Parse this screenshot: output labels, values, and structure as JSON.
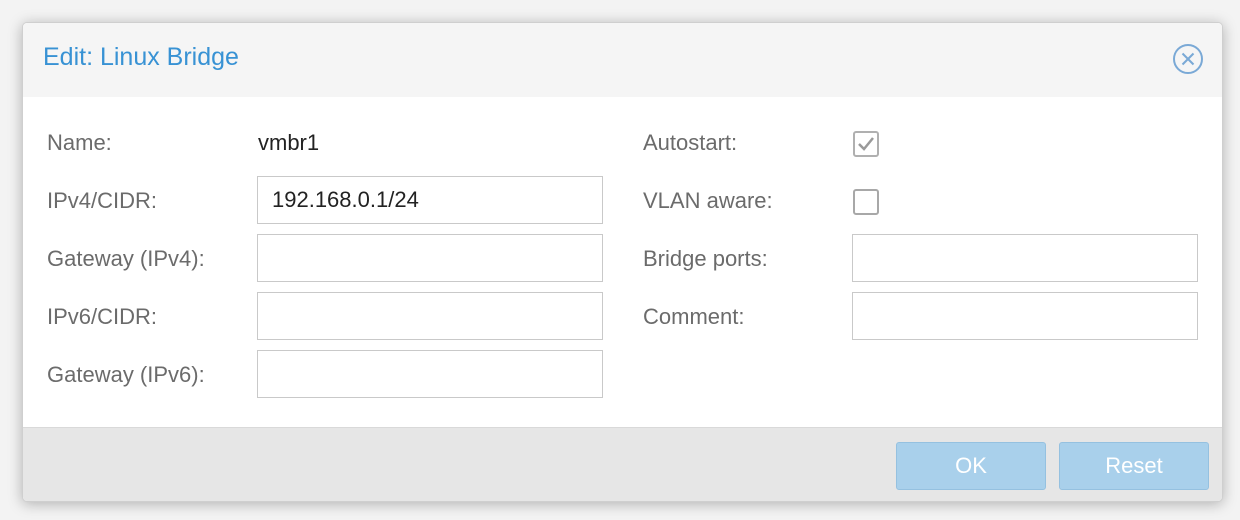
{
  "dialog": {
    "title": "Edit: Linux Bridge",
    "close_icon": "close-circle-icon"
  },
  "left": {
    "name_label": "Name:",
    "name_value": "vmbr1",
    "ipv4_label": "IPv4/CIDR:",
    "ipv4_value": "192.168.0.1/24",
    "gateway4_label": "Gateway (IPv4):",
    "gateway4_value": "",
    "ipv6_label": "IPv6/CIDR:",
    "ipv6_value": "",
    "gateway6_label": "Gateway (IPv6):",
    "gateway6_value": ""
  },
  "right": {
    "autostart_label": "Autostart:",
    "autostart_checked": true,
    "vlan_label": "VLAN aware:",
    "vlan_checked": false,
    "bridge_ports_label": "Bridge ports:",
    "bridge_ports_value": "",
    "comment_label": "Comment:",
    "comment_value": ""
  },
  "footer": {
    "ok_label": "OK",
    "reset_label": "Reset"
  },
  "colors": {
    "title": "#3892d4",
    "button_disabled": "#a9d0eb"
  }
}
